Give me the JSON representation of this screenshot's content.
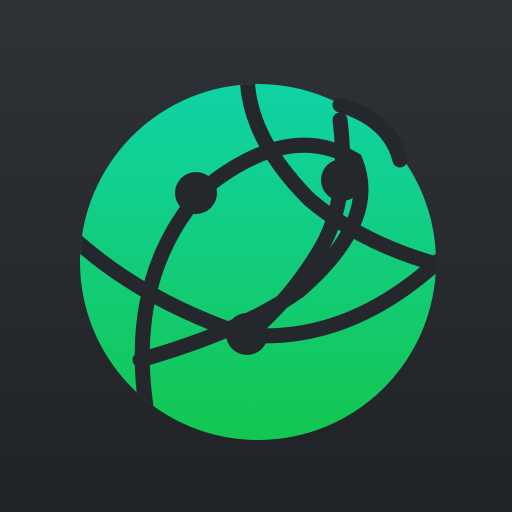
{
  "icon": {
    "name": "network-globe-icon",
    "colors": {
      "background_top": "#2f3236",
      "background_bottom": "#1f2226",
      "globe_top": "#10d3a6",
      "globe_bottom": "#14c650",
      "line": "#24272b"
    }
  }
}
